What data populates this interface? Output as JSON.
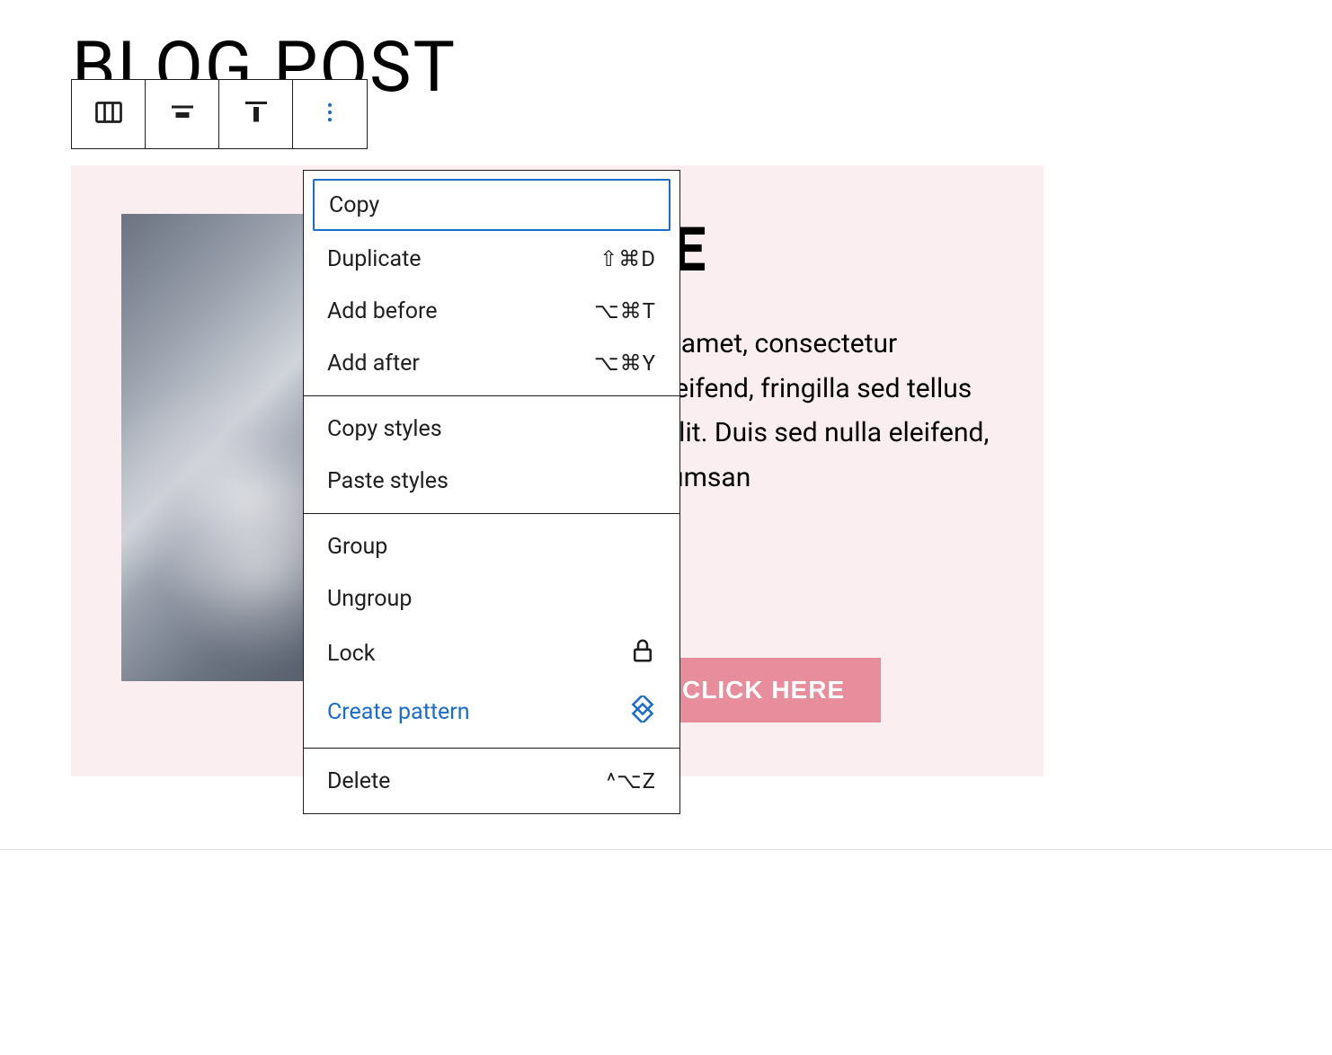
{
  "page": {
    "title": "BLOG POST"
  },
  "toolbar": {
    "icons": {
      "columns": "columns-icon",
      "align": "align-center-icon",
      "alignTop": "align-top-icon",
      "more": "more-vertical-icon"
    }
  },
  "content": {
    "headline": "HEADLINE",
    "paragraph": "Lorem ipsum dolor sit amet, consectetur adipiscing elit. Cras eleifend, fringilla sed tellus id, interdum porttitor elit. Duis sed nulla eleifend, semper orci eget, accumsan",
    "button": "CLICK HERE"
  },
  "menu": {
    "group1": [
      {
        "label": "Copy",
        "shortcut": "",
        "highlighted": true
      },
      {
        "label": "Duplicate",
        "shortcut": "⇧⌘D"
      },
      {
        "label": "Add before",
        "shortcut": "⌥⌘T"
      },
      {
        "label": "Add after",
        "shortcut": "⌥⌘Y"
      }
    ],
    "group2": [
      {
        "label": "Copy styles",
        "shortcut": ""
      },
      {
        "label": "Paste styles",
        "shortcut": ""
      }
    ],
    "group3": [
      {
        "label": "Group",
        "shortcut": ""
      },
      {
        "label": "Ungroup",
        "shortcut": ""
      },
      {
        "label": "Lock",
        "shortcut": "",
        "icon": "lock"
      },
      {
        "label": "Create pattern",
        "shortcut": "",
        "icon": "pattern",
        "blue": true
      }
    ],
    "group4": [
      {
        "label": "Delete",
        "shortcut": "^⌥Z"
      }
    ]
  }
}
